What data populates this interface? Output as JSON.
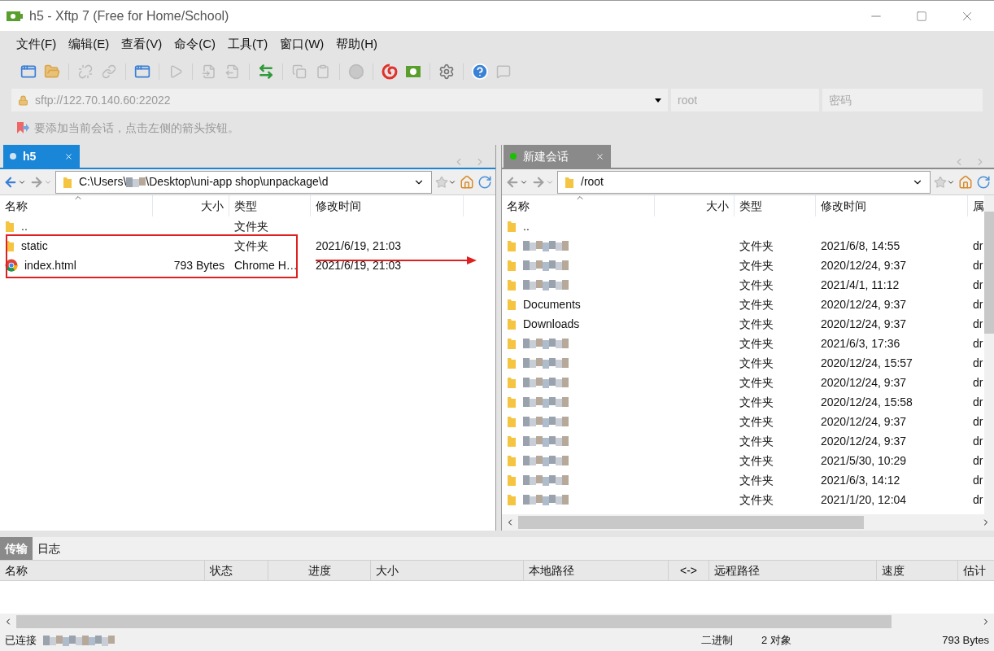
{
  "window": {
    "title": "h5 - Xftp 7 (Free for Home/School)"
  },
  "menu": [
    "文件(F)",
    "编辑(E)",
    "查看(V)",
    "命令(C)",
    "工具(T)",
    "窗口(W)",
    "帮助(H)"
  ],
  "address": {
    "value": "sftp://122.70.140.60:22022",
    "user_placeholder": "root",
    "password_placeholder": "密码"
  },
  "hint": "要添加当前会话，点击左侧的箭头按钮。",
  "left": {
    "tab": {
      "label": "h5",
      "selected": true
    },
    "path_start": "C:\\Users\\",
    "path_end": "\\Desktop\\uni-app shop\\unpackage\\d",
    "columns": [
      "名称",
      "大小",
      "类型",
      "修改时间"
    ],
    "rows": [
      {
        "name": "..",
        "kind": "folder",
        "type": "文件夹"
      },
      {
        "name": "static",
        "kind": "folder",
        "type": "文件夹",
        "modified": "2021/6/19, 21:03"
      },
      {
        "name": "index.html",
        "kind": "html",
        "size": "793 Bytes",
        "type": "Chrome H…",
        "modified": "2021/6/19, 21:03"
      }
    ]
  },
  "right": {
    "tab": {
      "label": "新建会话",
      "selected": false
    },
    "path": "/root",
    "columns": [
      "名称",
      "大小",
      "类型",
      "修改时间",
      "属"
    ],
    "rows": [
      {
        "name": ".."
      },
      {
        "redacted": true,
        "type": "文件夹",
        "modified": "2021/6/8, 14:55",
        "attr": "dr"
      },
      {
        "redacted": true,
        "type": "文件夹",
        "modified": "2020/12/24, 9:37",
        "attr": "dr"
      },
      {
        "redacted": true,
        "type": "文件夹",
        "modified": "2021/4/1, 11:12",
        "attr": "dr"
      },
      {
        "name": "Documents",
        "type": "文件夹",
        "modified": "2020/12/24, 9:37",
        "attr": "dr"
      },
      {
        "name": "Downloads",
        "type": "文件夹",
        "modified": "2020/12/24, 9:37",
        "attr": "dr"
      },
      {
        "redacted": true,
        "type": "文件夹",
        "modified": "2021/6/3, 17:36",
        "attr": "dr"
      },
      {
        "redacted": true,
        "type": "文件夹",
        "modified": "2020/12/24, 15:57",
        "attr": "dr"
      },
      {
        "redacted": true,
        "type": "文件夹",
        "modified": "2020/12/24, 9:37",
        "attr": "dr"
      },
      {
        "redacted": true,
        "type": "文件夹",
        "modified": "2020/12/24, 15:58",
        "attr": "dr"
      },
      {
        "redacted": true,
        "type": "文件夹",
        "modified": "2020/12/24, 9:37",
        "attr": "dr"
      },
      {
        "redacted": true,
        "type": "文件夹",
        "modified": "2020/12/24, 9:37",
        "attr": "dr"
      },
      {
        "redacted": true,
        "type": "文件夹",
        "modified": "2021/5/30, 10:29",
        "attr": "dr"
      },
      {
        "redacted": true,
        "type": "文件夹",
        "modified": "2021/6/3, 14:12",
        "attr": "dr"
      },
      {
        "redacted": true,
        "type": "文件夹",
        "modified": "2021/1/20, 12:04",
        "attr": "dr"
      }
    ]
  },
  "bottom": {
    "tabs": [
      {
        "label": "传输",
        "selected": true
      },
      {
        "label": "日志",
        "selected": false
      }
    ],
    "columns": [
      "名称",
      "状态",
      "进度",
      "大小",
      "本地路径",
      "<->",
      "远程路径",
      "速度",
      "估计"
    ]
  },
  "status_bar": {
    "connection": "已连接",
    "mode": "二进制",
    "objects": "2 对象",
    "size": "793 Bytes"
  }
}
